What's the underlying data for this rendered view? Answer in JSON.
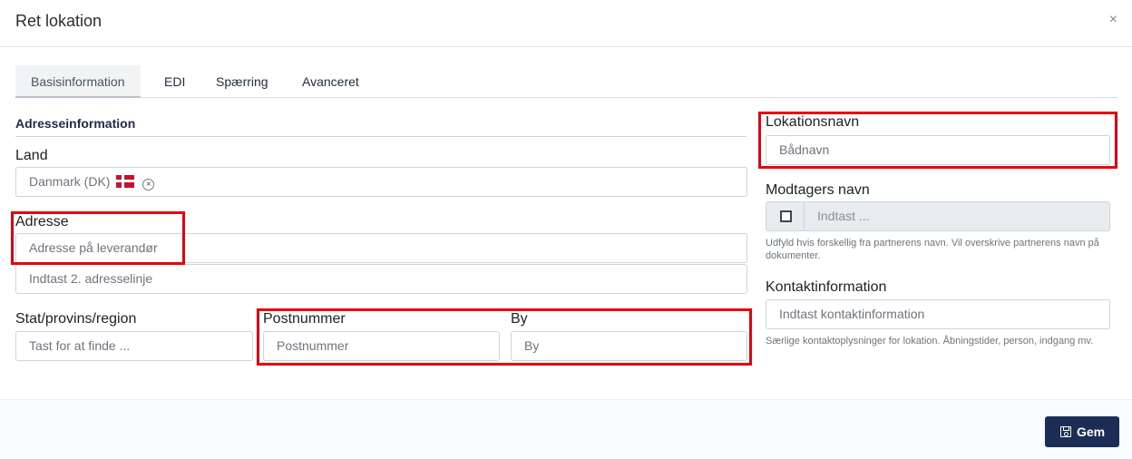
{
  "modal": {
    "title": "Ret lokation",
    "close_symbol": "×"
  },
  "tabs": [
    {
      "label": "Basisinformation",
      "active": true
    },
    {
      "label": "EDI",
      "active": false
    },
    {
      "label": "Spærring",
      "active": false
    },
    {
      "label": "Avanceret",
      "active": false
    }
  ],
  "address_section": {
    "title": "Adresseinformation",
    "country": {
      "label": "Land",
      "value": "Danmark (DK)",
      "flag_icon": "denmark-flag-icon",
      "clear_symbol": "×"
    },
    "address": {
      "label": "Adresse",
      "line1_placeholder": "Adresse på leverandør",
      "line2_placeholder": "Indtast 2. adresselinje"
    },
    "state": {
      "label": "Stat/provins/region",
      "placeholder": "Tast for at finde ..."
    },
    "postal": {
      "label": "Postnummer",
      "placeholder": "Postnummer"
    },
    "city": {
      "label": "By",
      "placeholder": "By"
    }
  },
  "right_panel": {
    "location_name": {
      "label": "Lokationsnavn",
      "placeholder": "Bådnavn"
    },
    "recipient_name": {
      "label": "Modtagers navn",
      "placeholder": "Indtast ...",
      "checked": false,
      "help": "Udfyld hvis forskellig fra partnerens navn. Vil overskrive partnerens navn på dokumenter."
    },
    "contact_info": {
      "label": "Kontaktinformation",
      "placeholder": "Indtast kontaktinformation",
      "help": "Særlige kontaktoplysninger for lokation. Åbningstider, person, indgang mv."
    }
  },
  "footer": {
    "save_label": "Gem",
    "save_icon": "floppy-disk-icon"
  },
  "colors": {
    "highlight_box": "#e8000f",
    "primary_button": "#1c2d55"
  }
}
